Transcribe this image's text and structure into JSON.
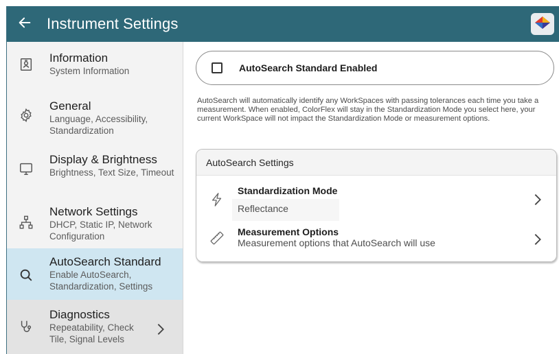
{
  "header": {
    "title": "Instrument Settings",
    "back_icon": "arrow-left-icon",
    "logo_icon": "colorflex-logo-icon"
  },
  "sidebar": {
    "items": [
      {
        "icon": "id-badge-icon",
        "title": "Information",
        "subtitle": "System Information"
      },
      {
        "icon": "gear-icon",
        "title": "General",
        "subtitle": "Language, Accessibility, Standardization"
      },
      {
        "icon": "monitor-icon",
        "title": "Display & Brightness",
        "subtitle": "Brightness, Text Size, Timeout"
      },
      {
        "icon": "network-icon",
        "title": "Network Settings",
        "subtitle": "DHCP, Static IP, Network Configuration"
      },
      {
        "icon": "search-icon",
        "title": "AutoSearch Standard",
        "subtitle": "Enable AutoSearch, Standardization, Settings",
        "active": true
      },
      {
        "icon": "stethoscope-icon",
        "title": "Diagnostics",
        "subtitle": "Repeatability, Check Tile, Signal Levels",
        "chevron": "chevron-right-icon"
      }
    ]
  },
  "main": {
    "toggle": {
      "label": "AutoSearch Standard Enabled",
      "checked": false
    },
    "description": "AutoSearch will automatically identify any WorkSpaces with passing tolerances each time you take a measurement. When enabled, ColorFlex will stay in the Standardization Mode you select here, your current WorkSpace will not impact the Standardization Mode or measurement options.",
    "card": {
      "header": "AutoSearch Settings",
      "rows": [
        {
          "icon": "lightning-icon",
          "title": "Standardization Mode",
          "value": "Reflectance",
          "chevron": "chevron-right-icon"
        },
        {
          "icon": "ruler-icon",
          "title": "Measurement Options",
          "value": "Measurement options that AutoSearch will use",
          "chevron": "chevron-right-icon"
        }
      ]
    }
  },
  "colors": {
    "appbar": "#2e6878",
    "active_nav": "#cfe6f1",
    "sidebar_bg": "#f3f3f3"
  }
}
